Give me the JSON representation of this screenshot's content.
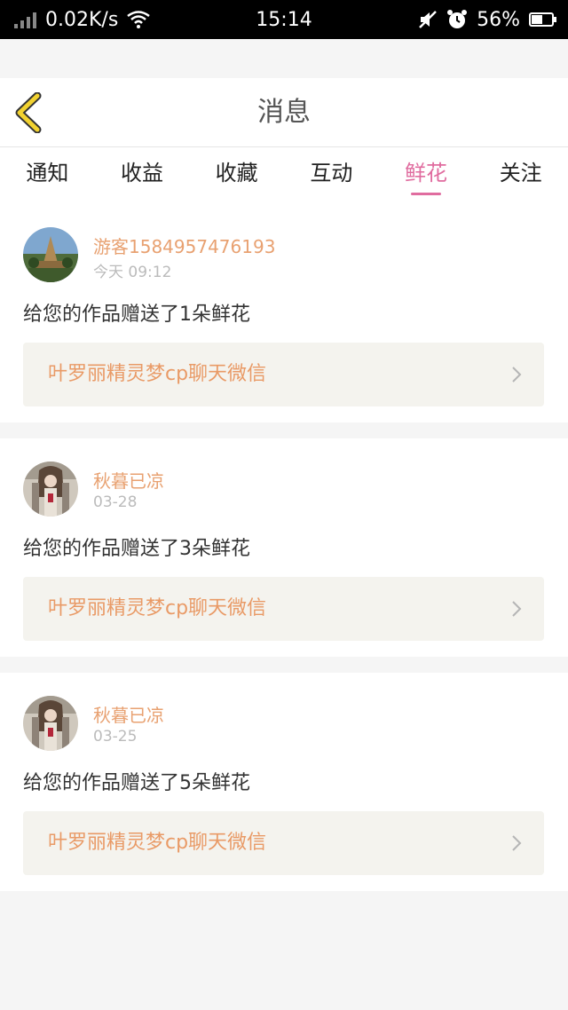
{
  "status_bar": {
    "speed": "0.02K/s",
    "time": "15:14",
    "battery": "56%",
    "battery_level": 0.56,
    "icons": [
      "signal-icon",
      "wifi-icon",
      "mute-icon",
      "alarm-icon",
      "battery-icon"
    ]
  },
  "header": {
    "title": "消息",
    "back_icon": "chevron-left-icon",
    "accent_color": "#f2d230"
  },
  "tabs": [
    {
      "label": "通知",
      "active": false
    },
    {
      "label": "收益",
      "active": false
    },
    {
      "label": "收藏",
      "active": false
    },
    {
      "label": "互动",
      "active": false
    },
    {
      "label": "鲜花",
      "active": true
    },
    {
      "label": "关注",
      "active": false
    }
  ],
  "colors": {
    "active_tab": "#e06c9f",
    "username": "#e8a171",
    "work_title": "#e99a66",
    "work_bg": "#f4f3ee"
  },
  "messages": [
    {
      "user": "游客1584957476193",
      "time": "今天 09:12",
      "text": "给您的作品赠送了1朵鲜花",
      "work": "叶罗丽精灵梦cp聊天微信",
      "avatar": "temple-avatar"
    },
    {
      "user": "秋暮已凉",
      "time": "03-28",
      "text": "给您的作品赠送了3朵鲜花",
      "work": "叶罗丽精灵梦cp聊天微信",
      "avatar": "girl-avatar"
    },
    {
      "user": "秋暮已凉",
      "time": "03-25",
      "text": "给您的作品赠送了5朵鲜花",
      "work": "叶罗丽精灵梦cp聊天微信",
      "avatar": "girl-avatar"
    }
  ]
}
